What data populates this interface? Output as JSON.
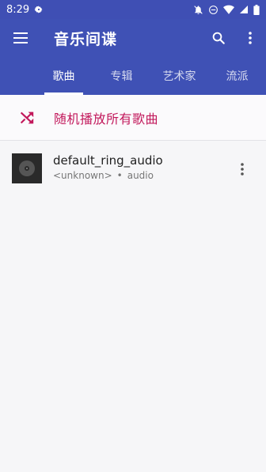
{
  "status_bar": {
    "time": "8:29"
  },
  "app_bar": {
    "title": "音乐间谍"
  },
  "tabs": [
    {
      "label": "歌曲",
      "active": true
    },
    {
      "label": "专辑",
      "active": false
    },
    {
      "label": "艺术家",
      "active": false
    },
    {
      "label": "流派",
      "active": false
    }
  ],
  "shuffle": {
    "label": "随机播放所有歌曲"
  },
  "songs": [
    {
      "title": "default_ring_audio",
      "artist": "<unknown>",
      "separator": "•",
      "album": "audio"
    }
  ],
  "colors": {
    "primary": "#3f51b5",
    "accent": "#c2185b",
    "background": "#f6f6f8"
  }
}
